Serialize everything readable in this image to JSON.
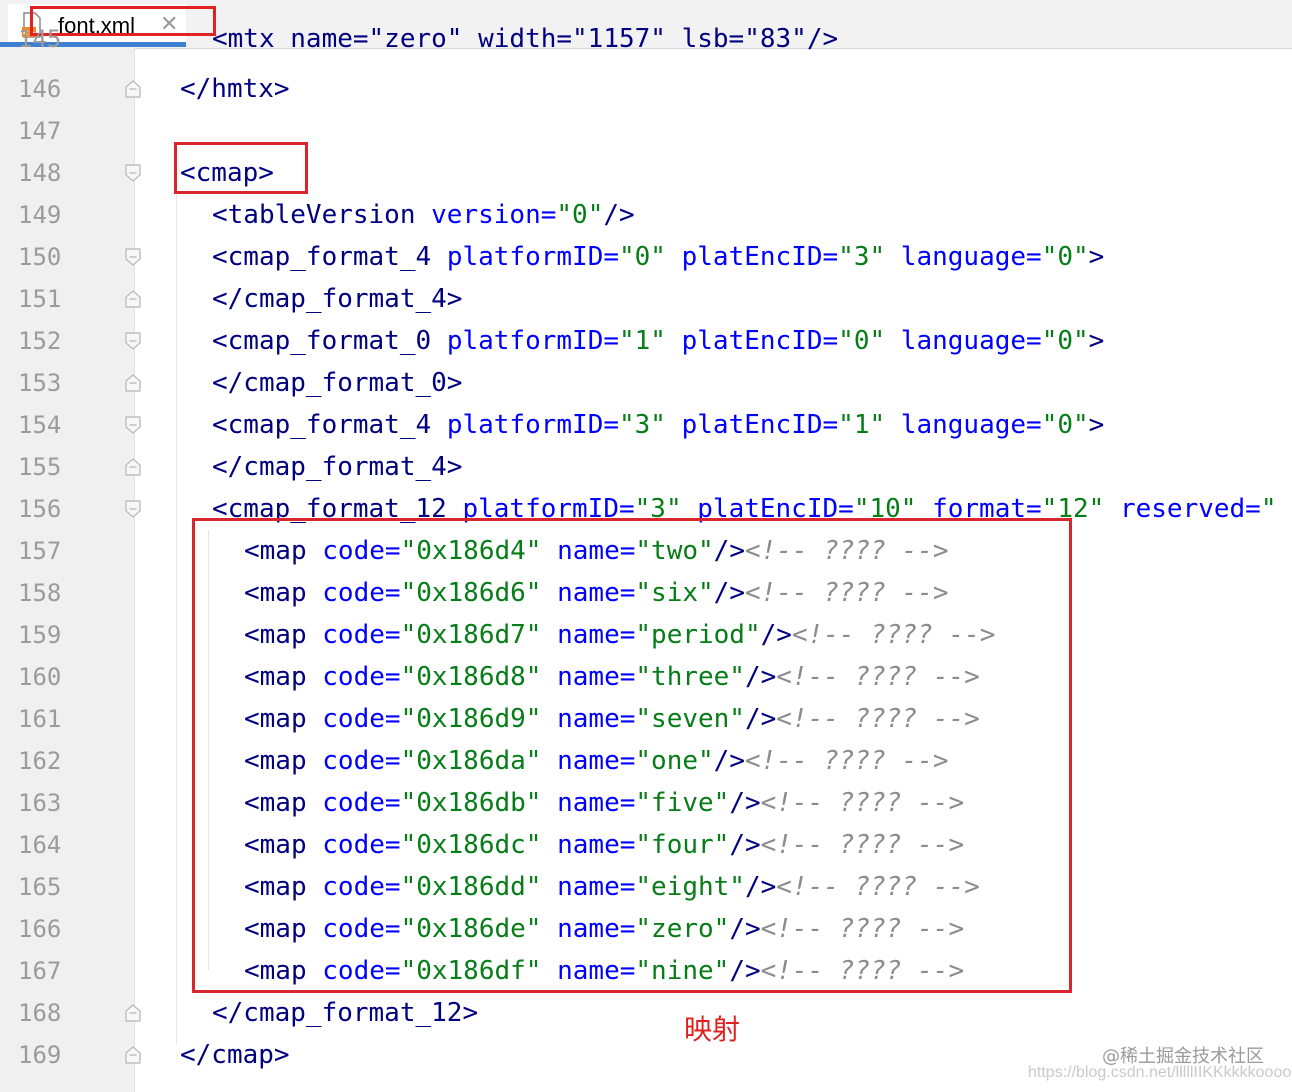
{
  "tab": {
    "label": "font.xml",
    "close": "✕",
    "icon": "xml-file-icon"
  },
  "partial_top_line": {
    "number": "145",
    "text": "<mtx name=\"zero\" width=\"1157\" lsb=\"83\"/>"
  },
  "lines": [
    {
      "n": "146",
      "fold": "end",
      "indent": 0,
      "parts": [
        [
          "tag",
          "</hmtx>"
        ]
      ]
    },
    {
      "n": "147",
      "fold": "none",
      "indent": 0,
      "parts": []
    },
    {
      "n": "148",
      "fold": "start",
      "indent": 0,
      "parts": [
        [
          "tag",
          "<cmap>"
        ]
      ]
    },
    {
      "n": "149",
      "fold": "none",
      "indent": 1,
      "parts": [
        [
          "tag",
          "<tableVersion "
        ],
        [
          "attr",
          "version="
        ],
        [
          "val",
          "\"0\""
        ],
        [
          "tag",
          "/>"
        ]
      ]
    },
    {
      "n": "150",
      "fold": "start",
      "indent": 1,
      "parts": [
        [
          "tag",
          "<cmap_format_4 "
        ],
        [
          "attr",
          "platformID="
        ],
        [
          "val",
          "\"0\" "
        ],
        [
          "attr",
          "platEncID="
        ],
        [
          "val",
          "\"3\" "
        ],
        [
          "attr",
          "language="
        ],
        [
          "val",
          "\"0\""
        ],
        [
          "tag",
          ">"
        ]
      ]
    },
    {
      "n": "151",
      "fold": "end",
      "indent": 1,
      "parts": [
        [
          "tag",
          "</cmap_format_4>"
        ]
      ]
    },
    {
      "n": "152",
      "fold": "start",
      "indent": 1,
      "parts": [
        [
          "tag",
          "<cmap_format_0 "
        ],
        [
          "attr",
          "platformID="
        ],
        [
          "val",
          "\"1\" "
        ],
        [
          "attr",
          "platEncID="
        ],
        [
          "val",
          "\"0\" "
        ],
        [
          "attr",
          "language="
        ],
        [
          "val",
          "\"0\""
        ],
        [
          "tag",
          ">"
        ]
      ]
    },
    {
      "n": "153",
      "fold": "end",
      "indent": 1,
      "parts": [
        [
          "tag",
          "</cmap_format_0>"
        ]
      ]
    },
    {
      "n": "154",
      "fold": "start",
      "indent": 1,
      "parts": [
        [
          "tag",
          "<cmap_format_4 "
        ],
        [
          "attr",
          "platformID="
        ],
        [
          "val",
          "\"3\" "
        ],
        [
          "attr",
          "platEncID="
        ],
        [
          "val",
          "\"1\" "
        ],
        [
          "attr",
          "language="
        ],
        [
          "val",
          "\"0\""
        ],
        [
          "tag",
          ">"
        ]
      ]
    },
    {
      "n": "155",
      "fold": "end",
      "indent": 1,
      "parts": [
        [
          "tag",
          "</cmap_format_4>"
        ]
      ]
    },
    {
      "n": "156",
      "fold": "start",
      "indent": 1,
      "parts": [
        [
          "tag",
          "<cmap_format_12 "
        ],
        [
          "attr",
          "platformID="
        ],
        [
          "val",
          "\"3\" "
        ],
        [
          "attr",
          "platEncID="
        ],
        [
          "val",
          "\"10\" "
        ],
        [
          "attr",
          "format="
        ],
        [
          "val",
          "\"12\" "
        ],
        [
          "attr",
          "reserved="
        ],
        [
          "val",
          "\""
        ]
      ]
    },
    {
      "n": "157",
      "fold": "none",
      "indent": 2,
      "parts": [
        [
          "tag",
          "<map "
        ],
        [
          "attr",
          "code="
        ],
        [
          "val",
          "\"0x186d4\" "
        ],
        [
          "attr",
          "name="
        ],
        [
          "val",
          "\"two\""
        ],
        [
          "tag",
          "/>"
        ],
        [
          "cmt",
          "<!-- ???? -->"
        ]
      ]
    },
    {
      "n": "158",
      "fold": "none",
      "indent": 2,
      "parts": [
        [
          "tag",
          "<map "
        ],
        [
          "attr",
          "code="
        ],
        [
          "val",
          "\"0x186d6\" "
        ],
        [
          "attr",
          "name="
        ],
        [
          "val",
          "\"six\""
        ],
        [
          "tag",
          "/>"
        ],
        [
          "cmt",
          "<!-- ???? -->"
        ]
      ]
    },
    {
      "n": "159",
      "fold": "none",
      "indent": 2,
      "parts": [
        [
          "tag",
          "<map "
        ],
        [
          "attr",
          "code="
        ],
        [
          "val",
          "\"0x186d7\" "
        ],
        [
          "attr",
          "name="
        ],
        [
          "val",
          "\"period\""
        ],
        [
          "tag",
          "/>"
        ],
        [
          "cmt",
          "<!-- ???? -->"
        ]
      ]
    },
    {
      "n": "160",
      "fold": "none",
      "indent": 2,
      "parts": [
        [
          "tag",
          "<map "
        ],
        [
          "attr",
          "code="
        ],
        [
          "val",
          "\"0x186d8\" "
        ],
        [
          "attr",
          "name="
        ],
        [
          "val",
          "\"three\""
        ],
        [
          "tag",
          "/>"
        ],
        [
          "cmt",
          "<!-- ???? -->"
        ]
      ]
    },
    {
      "n": "161",
      "fold": "none",
      "indent": 2,
      "parts": [
        [
          "tag",
          "<map "
        ],
        [
          "attr",
          "code="
        ],
        [
          "val",
          "\"0x186d9\" "
        ],
        [
          "attr",
          "name="
        ],
        [
          "val",
          "\"seven\""
        ],
        [
          "tag",
          "/>"
        ],
        [
          "cmt",
          "<!-- ???? -->"
        ]
      ]
    },
    {
      "n": "162",
      "fold": "none",
      "indent": 2,
      "parts": [
        [
          "tag",
          "<map "
        ],
        [
          "attr",
          "code="
        ],
        [
          "val",
          "\"0x186da\" "
        ],
        [
          "attr",
          "name="
        ],
        [
          "val",
          "\"one\""
        ],
        [
          "tag",
          "/>"
        ],
        [
          "cmt",
          "<!-- ???? -->"
        ]
      ]
    },
    {
      "n": "163",
      "fold": "none",
      "indent": 2,
      "parts": [
        [
          "tag",
          "<map "
        ],
        [
          "attr",
          "code="
        ],
        [
          "val",
          "\"0x186db\" "
        ],
        [
          "attr",
          "name="
        ],
        [
          "val",
          "\"five\""
        ],
        [
          "tag",
          "/>"
        ],
        [
          "cmt",
          "<!-- ???? -->"
        ]
      ]
    },
    {
      "n": "164",
      "fold": "none",
      "indent": 2,
      "parts": [
        [
          "tag",
          "<map "
        ],
        [
          "attr",
          "code="
        ],
        [
          "val",
          "\"0x186dc\" "
        ],
        [
          "attr",
          "name="
        ],
        [
          "val",
          "\"four\""
        ],
        [
          "tag",
          "/>"
        ],
        [
          "cmt",
          "<!-- ???? -->"
        ]
      ]
    },
    {
      "n": "165",
      "fold": "none",
      "indent": 2,
      "parts": [
        [
          "tag",
          "<map "
        ],
        [
          "attr",
          "code="
        ],
        [
          "val",
          "\"0x186dd\" "
        ],
        [
          "attr",
          "name="
        ],
        [
          "val",
          "\"eight\""
        ],
        [
          "tag",
          "/>"
        ],
        [
          "cmt",
          "<!-- ???? -->"
        ]
      ]
    },
    {
      "n": "166",
      "fold": "none",
      "indent": 2,
      "parts": [
        [
          "tag",
          "<map "
        ],
        [
          "attr",
          "code="
        ],
        [
          "val",
          "\"0x186de\" "
        ],
        [
          "attr",
          "name="
        ],
        [
          "val",
          "\"zero\""
        ],
        [
          "tag",
          "/>"
        ],
        [
          "cmt",
          "<!-- ???? -->"
        ]
      ]
    },
    {
      "n": "167",
      "fold": "none",
      "indent": 2,
      "parts": [
        [
          "tag",
          "<map "
        ],
        [
          "attr",
          "code="
        ],
        [
          "val",
          "\"0x186df\" "
        ],
        [
          "attr",
          "name="
        ],
        [
          "val",
          "\"nine\""
        ],
        [
          "tag",
          "/>"
        ],
        [
          "cmt",
          "<!-- ???? -->"
        ]
      ]
    },
    {
      "n": "168",
      "fold": "end",
      "indent": 1,
      "parts": [
        [
          "tag",
          "</cmap_format_12>"
        ]
      ]
    },
    {
      "n": "169",
      "fold": "end",
      "indent": 0,
      "parts": [
        [
          "tag",
          "</cmap>"
        ]
      ]
    }
  ],
  "annotation": "映射",
  "watermark": {
    "line1": "@稀土掘金技术社区",
    "line2": "https://blog.csdn.net/lllllIIKKkkkkooooo"
  },
  "colors": {
    "tag": "#000080",
    "attr": "#0000ff",
    "value": "#067d17",
    "comment": "#8c8c8c",
    "highlight": "#d9262e"
  }
}
